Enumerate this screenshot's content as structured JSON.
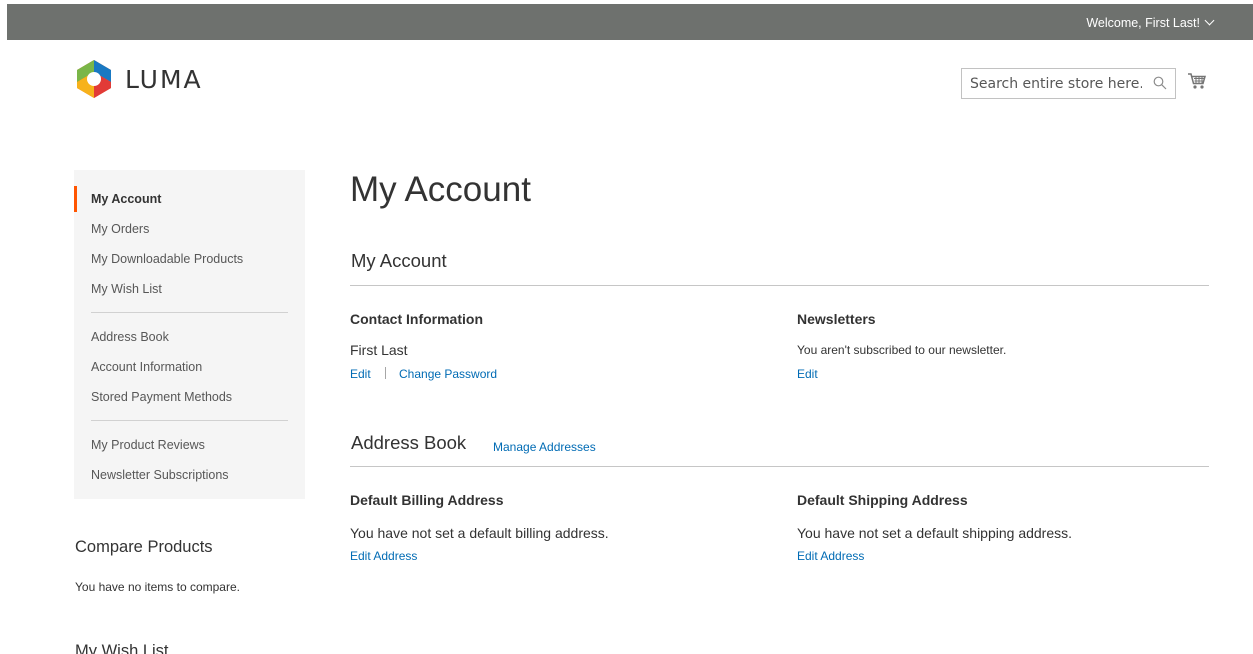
{
  "header": {
    "welcome_text": "Welcome, First Last!",
    "logo_text": "LUMA",
    "search_placeholder": "Search entire store here..."
  },
  "sidebar": {
    "items": [
      {
        "label": "My Account",
        "current": true
      },
      {
        "label": "My Orders"
      },
      {
        "label": "My Downloadable Products"
      },
      {
        "label": "My Wish List"
      },
      {
        "label": "Address Book"
      },
      {
        "label": "Account Information"
      },
      {
        "label": "Stored Payment Methods"
      },
      {
        "label": "My Product Reviews"
      },
      {
        "label": "Newsletter Subscriptions"
      }
    ],
    "compare_title": "Compare Products",
    "compare_text": "You have no items to compare.",
    "wishlist_title": "My Wish List"
  },
  "main": {
    "page_title": "My Account",
    "account_section_title": "My Account",
    "contact": {
      "title": "Contact Information",
      "name": "First Last",
      "edit_label": "Edit",
      "change_password_label": "Change Password"
    },
    "newsletters": {
      "title": "Newsletters",
      "text": "You aren't subscribed to our newsletter.",
      "edit_label": "Edit"
    },
    "address_section_title": "Address Book",
    "manage_addresses_label": "Manage Addresses",
    "billing": {
      "title": "Default Billing Address",
      "text": "You have not set a default billing address.",
      "edit_label": "Edit Address"
    },
    "shipping": {
      "title": "Default Shipping Address",
      "text": "You have not set a default shipping address.",
      "edit_label": "Edit Address"
    }
  },
  "colors": {
    "topbar": "#6e716e",
    "link": "#006bb4",
    "accent": "#ff5501",
    "sidebar_bg": "#f5f5f5"
  },
  "icons": [
    "luma-logo-icon",
    "search-icon",
    "cart-icon",
    "chevron-down-icon"
  ]
}
